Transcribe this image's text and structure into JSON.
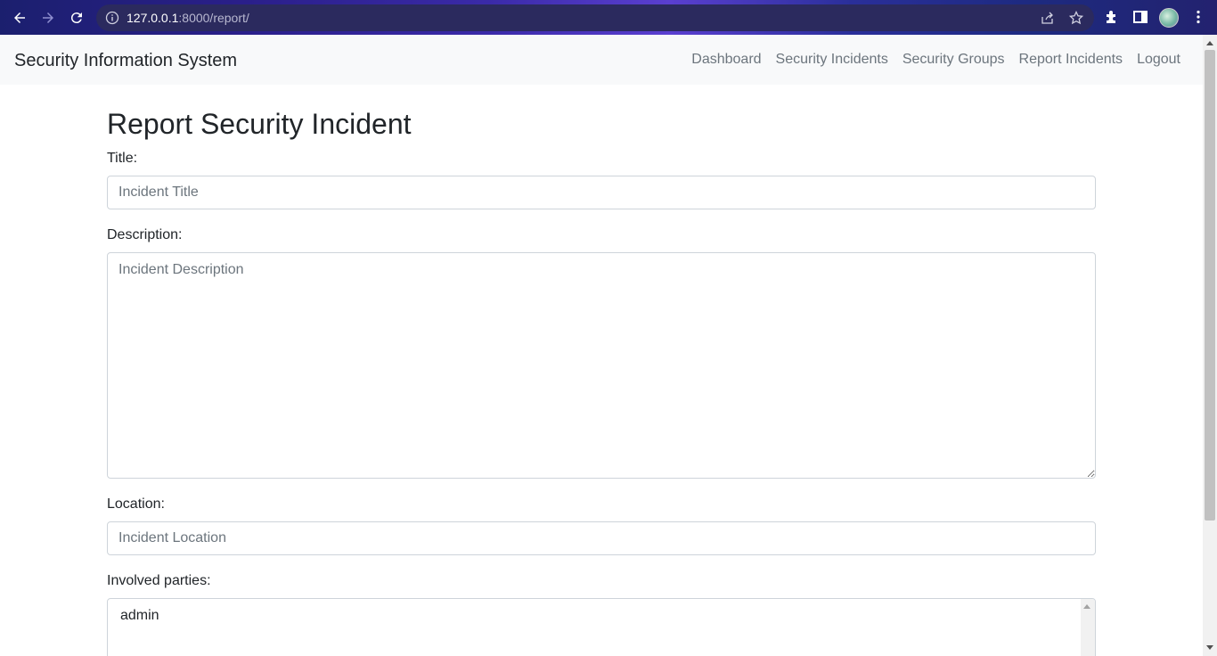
{
  "browser": {
    "url_host": "127.0.0.1",
    "url_rest": ":8000/report/"
  },
  "navbar": {
    "brand": "Security Information System",
    "links": [
      "Dashboard",
      "Security Incidents",
      "Security Groups",
      "Report Incidents",
      "Logout"
    ]
  },
  "form": {
    "heading": "Report Security Incident",
    "title_label": "Title:",
    "title_placeholder": "Incident Title",
    "description_label": "Description:",
    "description_placeholder": "Incident Description",
    "location_label": "Location:",
    "location_placeholder": "Incident Location",
    "parties_label": "Involved parties:",
    "parties_options": [
      "admin"
    ]
  }
}
